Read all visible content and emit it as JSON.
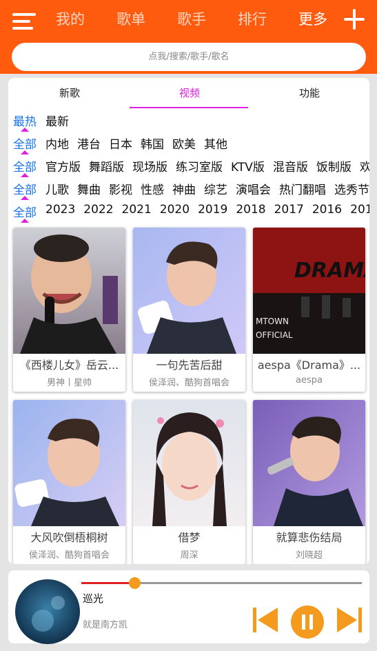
{
  "header": {
    "nav": [
      "我的",
      "歌单",
      "歌手",
      "排行",
      "更多"
    ],
    "active_index": 4,
    "search_placeholder": "点我/搜索/歌手/歌名",
    "icons": [
      "menu-icon",
      "plus-icon"
    ]
  },
  "tabs": {
    "items": [
      "新歌",
      "视频",
      "功能"
    ],
    "active_index": 1
  },
  "filters": [
    {
      "label": "最热",
      "options": [
        "最新"
      ]
    },
    {
      "label": "全部",
      "options": [
        "内地",
        "港台",
        "日本",
        "韩国",
        "欧美",
        "其他"
      ]
    },
    {
      "label": "全部",
      "options": [
        "官方版",
        "舞蹈版",
        "现场版",
        "练习室版",
        "KTV版",
        "混音版",
        "饭制版",
        "欢"
      ]
    },
    {
      "label": "全部",
      "options": [
        "儿歌",
        "舞曲",
        "影视",
        "性感",
        "神曲",
        "综艺",
        "演唱会",
        "热门翻唱",
        "选秀节"
      ]
    },
    {
      "label": "全部",
      "options": [
        "2023",
        "2022",
        "2021",
        "2020",
        "2019",
        "2018",
        "2017",
        "2016",
        "2015",
        "2"
      ]
    }
  ],
  "videos": [
    {
      "title": "《西楼儿女》岳云...",
      "subtitle": "男神丨星帅",
      "thumb_text": ""
    },
    {
      "title": "一句先苦后甜",
      "subtitle": "侯泽润、酷狗首唱会",
      "thumb_text": ""
    },
    {
      "title": "aespa《Drama》...",
      "subtitle": "aespa",
      "thumb_text": "DRAMA"
    },
    {
      "title": "大风吹倒梧桐树",
      "subtitle": "侯泽润、酷狗首唱会",
      "thumb_text": ""
    },
    {
      "title": "借梦",
      "subtitle": "周深",
      "thumb_text": ""
    },
    {
      "title": "就算悲伤结局",
      "subtitle": "刘晓超",
      "thumb_text": ""
    }
  ],
  "thumb_text_extra": {
    "mtown": "MTOWN",
    "official": "OFFICIAL"
  },
  "player": {
    "title": "巡光",
    "artist": "就是南方凯",
    "progress": 0.19,
    "controls": [
      "previous-icon",
      "pause-icon",
      "next-icon"
    ]
  },
  "colors": {
    "header": "#ff5b0f",
    "accent": "#e020e0",
    "filter_label": "#1a73e8",
    "control": "#f49b1f",
    "progress": "#e02020"
  }
}
